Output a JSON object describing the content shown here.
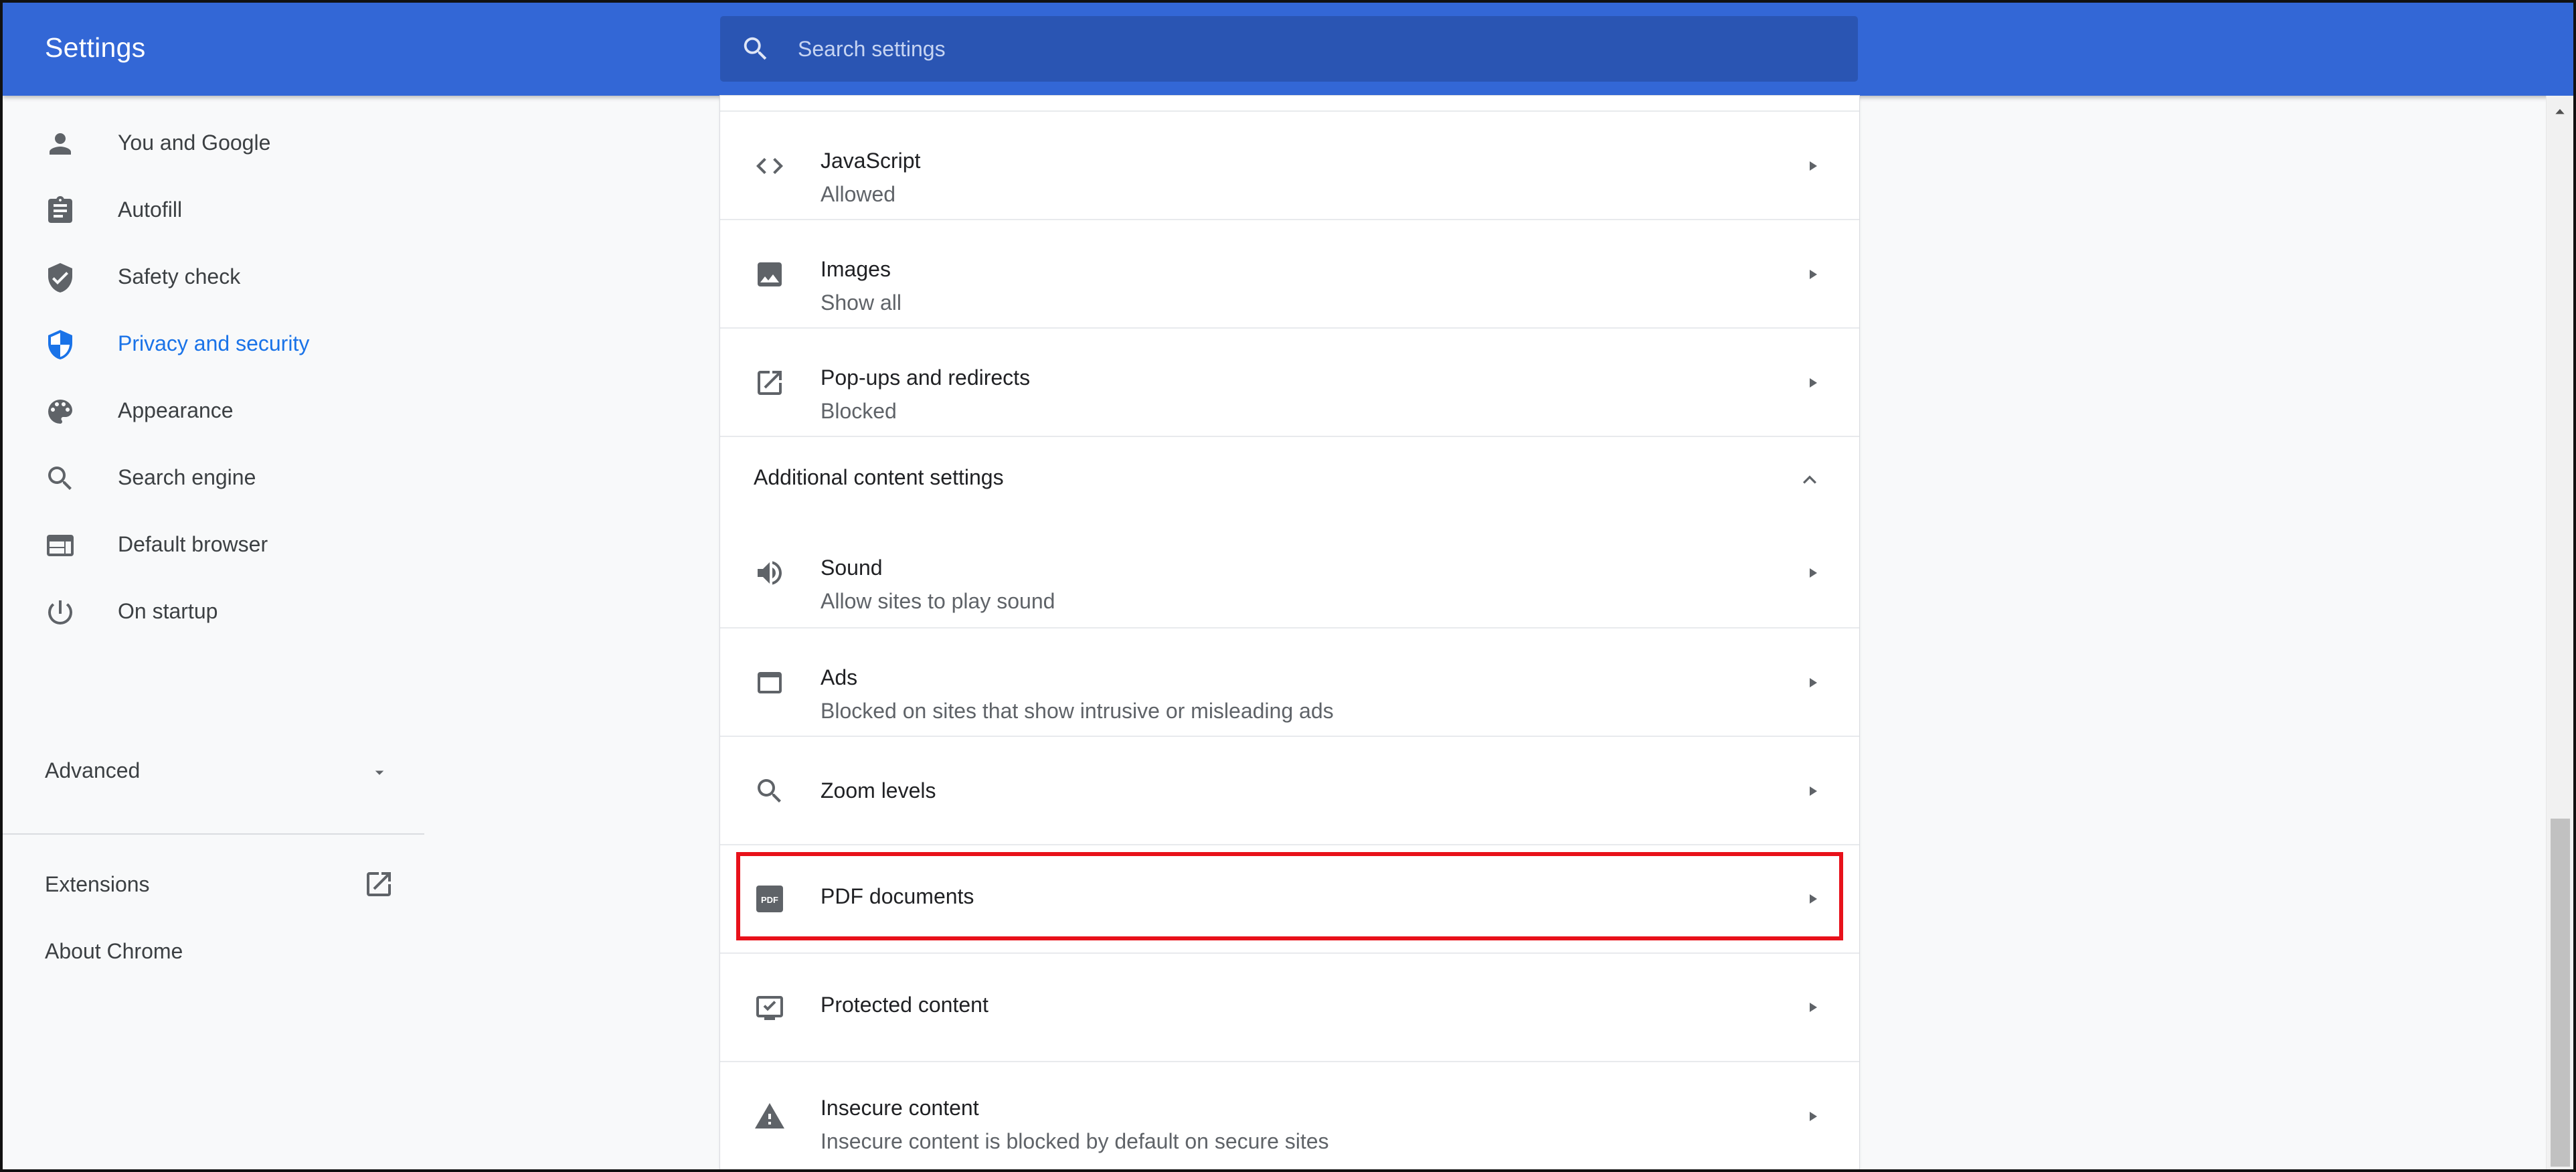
{
  "header": {
    "title": "Settings",
    "search_placeholder": "Search settings"
  },
  "sidebar": {
    "items": [
      {
        "label": "You and Google",
        "icon": "person-icon"
      },
      {
        "label": "Autofill",
        "icon": "clipboard-icon"
      },
      {
        "label": "Safety check",
        "icon": "shield-check-icon"
      },
      {
        "label": "Privacy and security",
        "icon": "shield-icon",
        "active": true
      },
      {
        "label": "Appearance",
        "icon": "palette-icon"
      },
      {
        "label": "Search engine",
        "icon": "search-icon"
      },
      {
        "label": "Default browser",
        "icon": "browser-icon"
      },
      {
        "label": "On startup",
        "icon": "power-icon"
      }
    ],
    "advanced_label": "Advanced",
    "extensions_label": "Extensions",
    "about_label": "About Chrome"
  },
  "content": {
    "rows_top": [
      {
        "title": "JavaScript",
        "subtitle": "Allowed",
        "icon": "code-icon"
      },
      {
        "title": "Images",
        "subtitle": "Show all",
        "icon": "image-icon"
      },
      {
        "title": "Pop-ups and redirects",
        "subtitle": "Blocked",
        "icon": "open-in-new-icon"
      }
    ],
    "section_label": "Additional content settings",
    "rows_bottom": [
      {
        "title": "Sound",
        "subtitle": "Allow sites to play sound",
        "icon": "volume-icon"
      },
      {
        "title": "Ads",
        "subtitle": "Blocked on sites that show intrusive or misleading ads",
        "icon": "window-icon"
      },
      {
        "title": "Zoom levels",
        "icon": "search-icon"
      },
      {
        "title": "PDF documents",
        "icon": "pdf-icon",
        "highlighted": true
      },
      {
        "title": "Protected content",
        "icon": "monitor-check-icon"
      },
      {
        "title": "Insecure content",
        "subtitle": "Insecure content is blocked by default on secure sites",
        "icon": "warning-icon"
      }
    ]
  },
  "colors": {
    "header": "#3367d6",
    "search_box": "#2a55b3",
    "active_nav": "#1a73e8",
    "highlight": "#e8111a"
  }
}
